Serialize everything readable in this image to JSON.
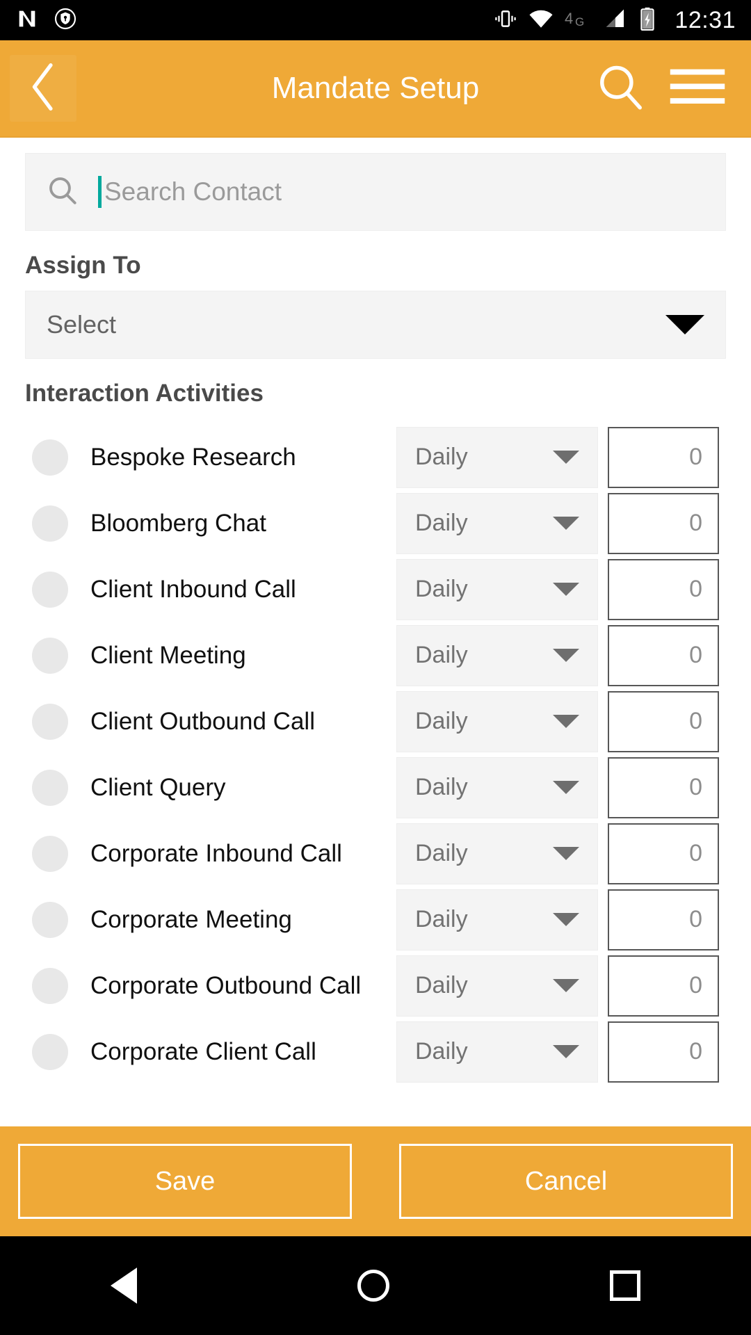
{
  "statusbar": {
    "icons": [
      "android-n-logo-icon",
      "vpn-key-shield-icon",
      "vibrate-icon",
      "wifi-icon",
      "network-4g-icon",
      "signal-bars-icon",
      "battery-charging-icon"
    ],
    "network_label": "4G",
    "time": "12:31"
  },
  "appbar": {
    "title": "Mandate Setup",
    "back_icon": "back-chevron-icon",
    "search_icon": "search-icon",
    "menu_icon": "hamburger-menu-icon",
    "background_color": "#EFA937"
  },
  "search": {
    "placeholder": "Search Contact",
    "value": "",
    "icon": "search-icon",
    "caret_color": "#00A99D"
  },
  "assign_to": {
    "label": "Assign To",
    "select_value": "Select",
    "caret_icon": "chevron-down-icon"
  },
  "interaction": {
    "label": "Interaction Activities",
    "rows": [
      {
        "name": "Bespoke Research",
        "frequency": "Daily",
        "count": "0"
      },
      {
        "name": "Bloomberg Chat",
        "frequency": "Daily",
        "count": "0"
      },
      {
        "name": "Client Inbound Call",
        "frequency": "Daily",
        "count": "0"
      },
      {
        "name": "Client Meeting",
        "frequency": "Daily",
        "count": "0"
      },
      {
        "name": "Client Outbound Call",
        "frequency": "Daily",
        "count": "0"
      },
      {
        "name": "Client Query",
        "frequency": "Daily",
        "count": "0"
      },
      {
        "name": "Corporate Inbound Call",
        "frequency": "Daily",
        "count": "0"
      },
      {
        "name": "Corporate Meeting",
        "frequency": "Daily",
        "count": "0"
      },
      {
        "name": "Corporate Outbound Call",
        "frequency": "Daily",
        "count": "0"
      },
      {
        "name": "Corporate Client Call",
        "frequency": "Daily",
        "count": "0"
      }
    ]
  },
  "footer": {
    "save_label": "Save",
    "cancel_label": "Cancel"
  },
  "navbar": {
    "back_icon": "nav-back-triangle-icon",
    "home_icon": "nav-home-circle-icon",
    "recents_icon": "nav-recents-square-icon"
  }
}
